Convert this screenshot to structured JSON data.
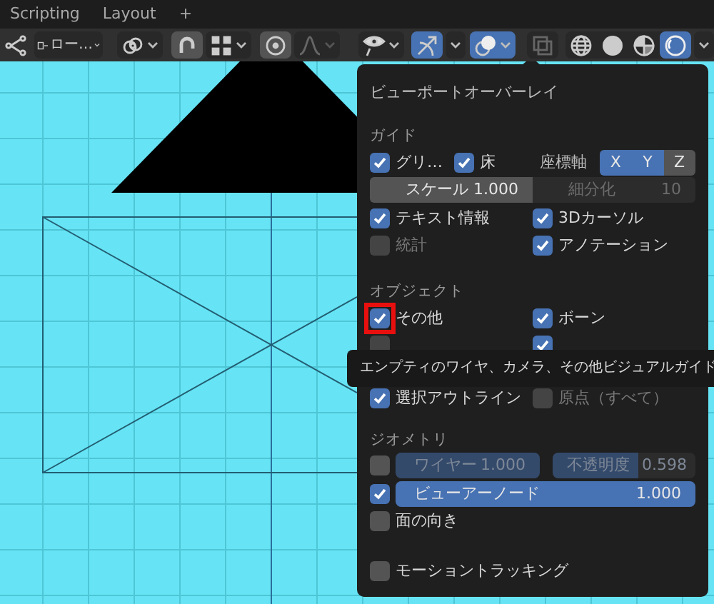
{
  "header": {
    "tabs": [
      {
        "label": "Scripting"
      },
      {
        "label": "Layout"
      },
      {
        "label": "+"
      }
    ]
  },
  "toolbar": {
    "left": [
      {
        "kind": "object_type",
        "selected": false,
        "disabled": false
      },
      {
        "kind": "transform",
        "label": "ロー…",
        "selected": false,
        "disabled": false
      },
      {
        "kind": "link",
        "selected": false,
        "disabled": false
      },
      {
        "kind": "snap",
        "selected": true,
        "disabled": false
      },
      {
        "kind": "snap_target",
        "selected": false,
        "disabled": false
      },
      {
        "kind": "proportional",
        "selected": true,
        "disabled": false
      },
      {
        "kind": "falloff",
        "selected": false,
        "disabled": true
      }
    ],
    "right": [
      {
        "kind": "visibility",
        "selected": false,
        "disabled": false
      },
      {
        "kind": "gizmo",
        "selected": true,
        "disabled": false
      },
      {
        "kind": "overlays",
        "selected": true,
        "disabled": false
      },
      {
        "kind": "xray",
        "selected": false,
        "disabled": true
      },
      {
        "kind": "wireframe",
        "selected": false,
        "disabled": false
      },
      {
        "kind": "solid",
        "selected": false,
        "disabled": false
      },
      {
        "kind": "material",
        "selected": false,
        "disabled": false
      },
      {
        "kind": "rendered",
        "selected": true,
        "disabled": false
      }
    ]
  },
  "overlays_popover": {
    "title": "ビューポートオーバーレイ",
    "sections": [
      {
        "heading": "ガイド",
        "rows": [
          {
            "kind": "guides",
            "items": [
              {
                "label": "グリ…",
                "checked": true,
                "disabled": false
              },
              {
                "label": "床",
                "checked": true,
                "disabled": false
              }
            ],
            "axes_label": "座標軸",
            "axes": [
              {
                "label": "X",
                "selected": true
              },
              {
                "label": "Y",
                "selected": true
              },
              {
                "label": "Z",
                "selected": false
              }
            ]
          },
          {
            "kind": "fields",
            "fields": [
              {
                "label": "スケール",
                "value": "1.000",
                "disabled": false
              },
              {
                "label": "細分化",
                "value": "10",
                "disabled": true
              }
            ]
          },
          {
            "kind": "checks",
            "items": [
              {
                "label": "テキスト情報",
                "checked": true,
                "disabled": false
              },
              {
                "label": "3Dカーソル",
                "checked": true,
                "disabled": false
              }
            ]
          },
          {
            "kind": "checks",
            "items": [
              {
                "label": "統計",
                "checked": false,
                "disabled": true
              },
              {
                "label": "アノテーション",
                "checked": true,
                "disabled": false
              }
            ]
          }
        ]
      },
      {
        "heading": "オブジェクト",
        "rows": [
          {
            "kind": "checks",
            "items": [
              {
                "label": "その他",
                "checked": true,
                "disabled": false,
                "highlighted": true
              },
              {
                "label": "ボーン",
                "checked": true,
                "disabled": false,
                "highlighted": false
              }
            ]
          },
          {
            "kind": "checks",
            "items": [
              {
                "checked": false,
                "disabled": true
              },
              {
                "checked": true,
                "disabled": false
              }
            ]
          },
          {
            "kind": "checks",
            "items": [
              {
                "label": "選択アウトライン",
                "checked": true,
                "disabled": false
              },
              {
                "label": "原点（すべて）",
                "checked": false,
                "disabled": true
              }
            ]
          }
        ]
      },
      {
        "heading": "ジオメトリ",
        "rows": [
          {
            "kind": "sliders",
            "checked": false,
            "sliders": [
              {
                "label": "ワイヤー",
                "value": "1.000",
                "level": 1,
                "disabled": true
              },
              {
                "label": "不透明度",
                "value": "0.598",
                "level": 0.598,
                "disabled": true
              }
            ]
          },
          {
            "kind": "sliders",
            "checked": true,
            "sliders": [
              {
                "label": "ビューアーノード",
                "value": "1.000",
                "level": 1,
                "disabled": false
              }
            ]
          },
          {
            "kind": "checks",
            "items": [
              {
                "label": "面の向き",
                "checked": false,
                "disabled": false
              }
            ]
          }
        ]
      },
      {
        "rows": [
          {
            "kind": "checks",
            "items": [
              {
                "label": "モーショントラッキング",
                "checked": false,
                "disabled": false
              }
            ]
          }
        ]
      }
    ]
  },
  "tooltip": {
    "text": "エンプティのワイヤ、カメラ、その他ビジュアルガイド"
  }
}
